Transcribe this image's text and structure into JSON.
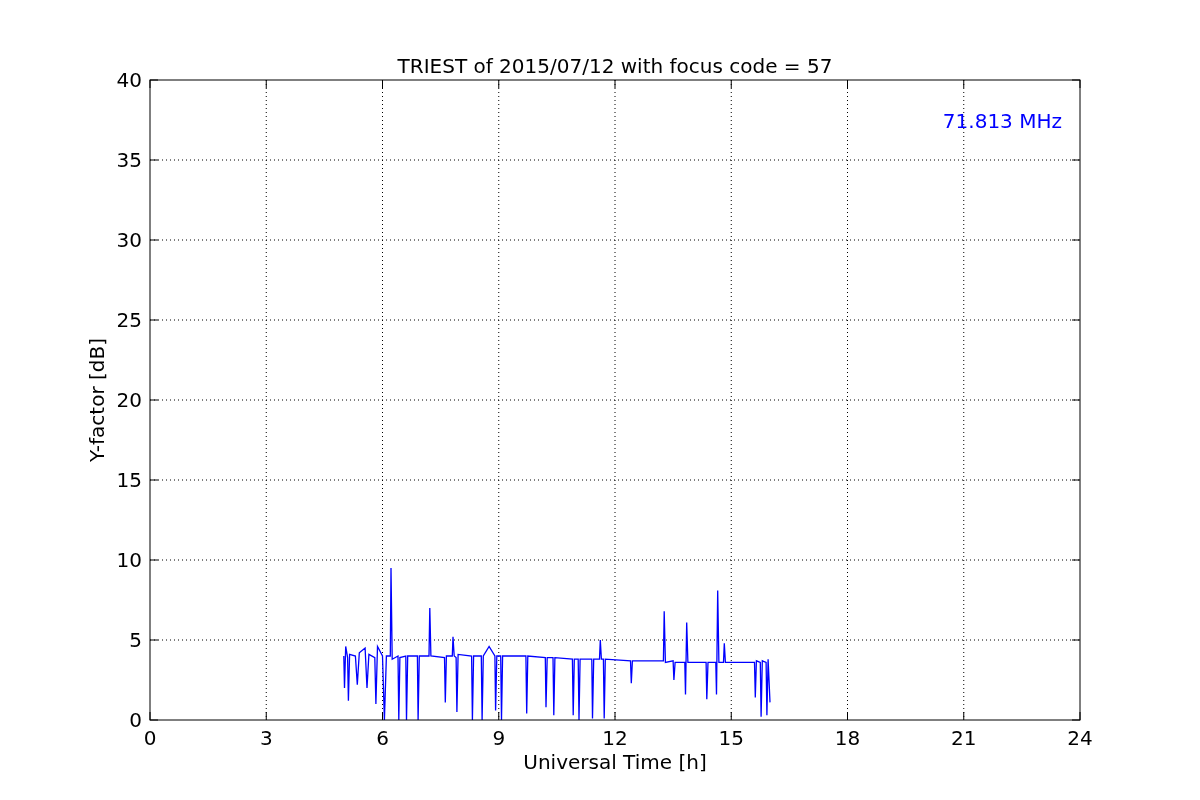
{
  "chart_data": {
    "type": "line",
    "title": "TRIEST of 2015/07/12 with focus code = 57",
    "xlabel": "Universal Time [h]",
    "ylabel": "Y-factor [dB]",
    "xlim": [
      0,
      24
    ],
    "ylim": [
      0,
      40
    ],
    "xticks": [
      0,
      3,
      6,
      9,
      12,
      15,
      18,
      21,
      24
    ],
    "yticks": [
      0,
      5,
      10,
      15,
      20,
      25,
      30,
      35,
      40
    ],
    "x": [
      5.0,
      5.02,
      5.05,
      5.1,
      5.12,
      5.15,
      5.3,
      5.35,
      5.4,
      5.55,
      5.6,
      5.65,
      5.8,
      5.83,
      5.87,
      6.0,
      6.05,
      6.1,
      6.2,
      6.22,
      6.25,
      6.4,
      6.42,
      6.45,
      6.6,
      6.62,
      6.65,
      6.9,
      6.92,
      6.95,
      7.2,
      7.22,
      7.25,
      7.6,
      7.62,
      7.65,
      7.8,
      7.82,
      7.85,
      7.9,
      7.92,
      7.95,
      8.3,
      8.32,
      8.35,
      8.55,
      8.57,
      8.6,
      8.75,
      8.9,
      8.92,
      8.95,
      9.05,
      9.07,
      9.1,
      9.7,
      9.72,
      9.75,
      10.2,
      10.22,
      10.25,
      10.4,
      10.42,
      10.45,
      10.9,
      10.92,
      10.95,
      11.05,
      11.07,
      11.1,
      11.4,
      11.42,
      11.45,
      11.6,
      11.62,
      11.65,
      11.7,
      11.72,
      11.75,
      12.4,
      12.42,
      12.45,
      13.25,
      13.27,
      13.3,
      13.5,
      13.52,
      13.55,
      13.8,
      13.82,
      13.85,
      13.88,
      14.35,
      14.37,
      14.4,
      14.6,
      14.62,
      14.65,
      14.68,
      14.8,
      14.82,
      14.85,
      15.6,
      15.62,
      15.65,
      15.75,
      15.77,
      15.8,
      15.9,
      15.92,
      15.95,
      16.0
    ],
    "series": [
      {
        "name": "71.813 MHz",
        "color": "#0000ff",
        "values": [
          4.0,
          2.0,
          4.6,
          3.9,
          1.2,
          4.1,
          4.0,
          2.2,
          4.2,
          4.5,
          2.0,
          4.1,
          3.9,
          1.0,
          4.6,
          4.0,
          0.0,
          4.0,
          4.0,
          9.5,
          3.8,
          4.0,
          0.0,
          3.9,
          4.0,
          0.0,
          4.0,
          4.0,
          0.0,
          4.0,
          4.0,
          7.0,
          4.0,
          3.9,
          1.1,
          4.0,
          4.0,
          5.2,
          4.0,
          3.9,
          0.5,
          4.1,
          4.0,
          0.0,
          4.0,
          4.0,
          0.0,
          4.0,
          4.6,
          4.0,
          0.6,
          4.0,
          4.0,
          0.0,
          4.0,
          4.0,
          0.4,
          4.0,
          3.9,
          0.8,
          3.9,
          3.9,
          0.3,
          3.9,
          3.8,
          0.3,
          3.8,
          3.8,
          0.0,
          3.8,
          3.8,
          0.1,
          3.8,
          3.8,
          5.0,
          3.8,
          3.8,
          0.1,
          3.8,
          3.7,
          2.3,
          3.7,
          3.7,
          6.8,
          3.6,
          3.7,
          2.5,
          3.6,
          3.6,
          1.6,
          6.1,
          3.6,
          3.6,
          1.3,
          3.6,
          3.6,
          1.6,
          8.1,
          3.6,
          3.6,
          4.8,
          3.6,
          3.6,
          1.4,
          3.7,
          3.6,
          0.2,
          3.7,
          3.6,
          0.3,
          3.8,
          1.1
        ]
      }
    ],
    "grid": true
  }
}
